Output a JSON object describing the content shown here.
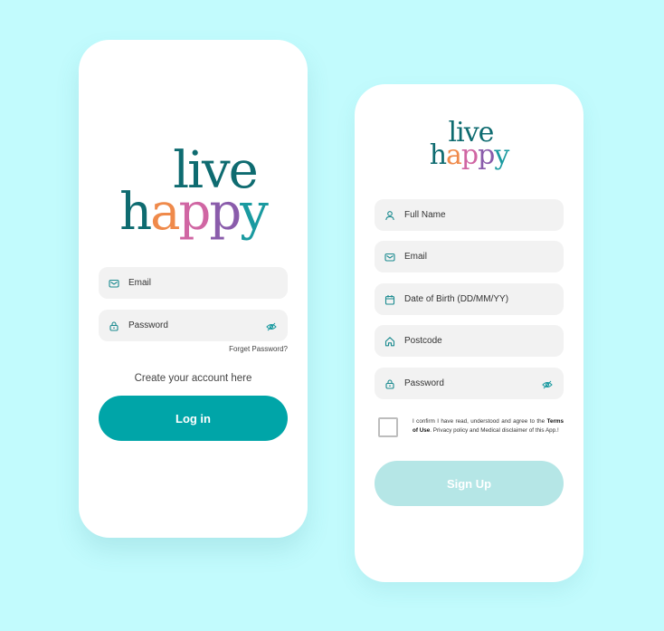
{
  "brand": {
    "word1": "live",
    "word2": "happy"
  },
  "login": {
    "email_placeholder": "Email",
    "password_placeholder": "Password",
    "forgot_label": "Forget Password?",
    "create_account_label": "Create your account here",
    "login_button_label": "Log in"
  },
  "signup": {
    "fields": [
      {
        "label": "Full Name",
        "icon": "user-icon"
      },
      {
        "label": "Email",
        "icon": "mail-icon"
      },
      {
        "label": "Date of Birth (DD/MM/YY)",
        "icon": "calendar-icon"
      },
      {
        "label": "Postcode",
        "icon": "home-icon"
      },
      {
        "label": "Password",
        "icon": "lock-icon"
      }
    ],
    "terms": {
      "prefix": "I confirm I have read, understood and agree to the",
      "link": "Terms of Use",
      "suffix": ". Privacy policy and Medical disclaimer of this App.!"
    },
    "signup_button_label": "Sign Up"
  },
  "colors": {
    "background": "#c2fbfd",
    "accent": "#00a5a8",
    "accent_disabled": "#b5e6e6",
    "icon": "#1a8a8f"
  }
}
